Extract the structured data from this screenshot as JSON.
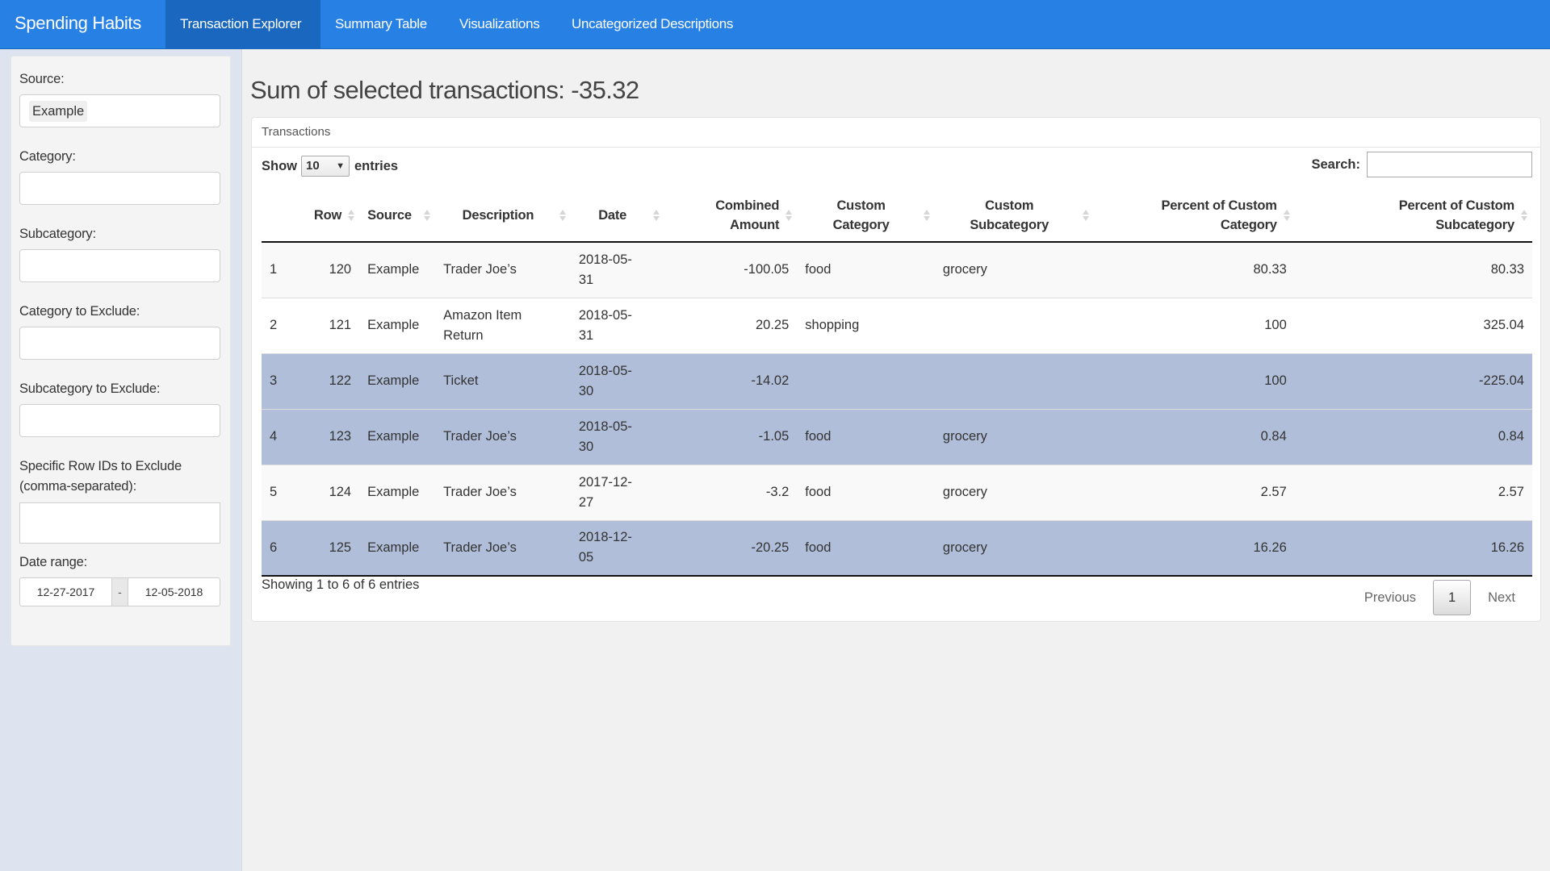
{
  "navbar": {
    "brand": "Spending Habits",
    "tabs": [
      {
        "label": "Transaction Explorer",
        "active": true
      },
      {
        "label": "Summary Table",
        "active": false
      },
      {
        "label": "Visualizations",
        "active": false
      },
      {
        "label": "Uncategorized Descriptions",
        "active": false
      }
    ]
  },
  "sidebar": {
    "source": {
      "label": "Source:",
      "selected": "Example"
    },
    "category": {
      "label": "Category:",
      "value": ""
    },
    "subcategory": {
      "label": "Subcategory:",
      "value": ""
    },
    "category_exclude": {
      "label": "Category to Exclude:",
      "value": ""
    },
    "subcategory_exclude": {
      "label": "Subcategory to Exclude:",
      "value": ""
    },
    "row_ids_exclude": {
      "label_line1": "Specific Row IDs to Exclude",
      "label_line2": "(comma-separated):",
      "value": ""
    },
    "date_range": {
      "label": "Date range:",
      "start": "12-27-2017",
      "separator": "-",
      "end": "12-05-2018"
    }
  },
  "main": {
    "summary": "Sum of selected transactions: -35.32",
    "box_title": "Transactions",
    "length": {
      "show": "Show",
      "value": "10",
      "arrow": "▼",
      "entries": "entries"
    },
    "search": {
      "label": "Search:",
      "value": ""
    },
    "columns": [
      {
        "key": "idx",
        "label": ""
      },
      {
        "key": "row",
        "label": "Row"
      },
      {
        "key": "source",
        "label": "Source"
      },
      {
        "key": "description",
        "label": "Description"
      },
      {
        "key": "date",
        "label": "Date"
      },
      {
        "key": "amount",
        "label_line1": "Combined",
        "label_line2": "Amount"
      },
      {
        "key": "custom_category",
        "label_line1": "Custom",
        "label_line2": "Category"
      },
      {
        "key": "custom_subcategory",
        "label_line1": "Custom",
        "label_line2": "Subcategory"
      },
      {
        "key": "pct_category",
        "label_line1": "Percent of Custom",
        "label_line2": "Category"
      },
      {
        "key": "pct_subcategory",
        "label_line1": "Percent of Custom",
        "label_line2": "Subcategory"
      }
    ],
    "rows": [
      {
        "idx": "1",
        "row": "120",
        "source": "Example",
        "description": "Trader Joe’s",
        "date_a": "2018-05-",
        "date_b": "31",
        "amount": "-100.05",
        "custom_category": "food",
        "custom_subcategory": "grocery",
        "pct_category": "80.33",
        "pct_subcategory": "80.33",
        "selected": false
      },
      {
        "idx": "2",
        "row": "121",
        "source": "Example",
        "description": "Amazon Item Return",
        "date_a": "2018-05-",
        "date_b": "31",
        "amount": "20.25",
        "custom_category": "shopping",
        "custom_subcategory": "",
        "pct_category": "100",
        "pct_subcategory": "325.04",
        "selected": false
      },
      {
        "idx": "3",
        "row": "122",
        "source": "Example",
        "description": "Ticket",
        "date_a": "2018-05-",
        "date_b": "30",
        "amount": "-14.02",
        "custom_category": "",
        "custom_subcategory": "",
        "pct_category": "100",
        "pct_subcategory": "-225.04",
        "selected": true
      },
      {
        "idx": "4",
        "row": "123",
        "source": "Example",
        "description": "Trader Joe’s",
        "date_a": "2018-05-",
        "date_b": "30",
        "amount": "-1.05",
        "custom_category": "food",
        "custom_subcategory": "grocery",
        "pct_category": "0.84",
        "pct_subcategory": "0.84",
        "selected": true
      },
      {
        "idx": "5",
        "row": "124",
        "source": "Example",
        "description": "Trader Joe’s",
        "date_a": "2017-12-",
        "date_b": "27",
        "amount": "-3.2",
        "custom_category": "food",
        "custom_subcategory": "grocery",
        "pct_category": "2.57",
        "pct_subcategory": "2.57",
        "selected": false
      },
      {
        "idx": "6",
        "row": "125",
        "source": "Example",
        "description": "Trader Joe’s",
        "date_a": "2018-12-",
        "date_b": "05",
        "amount": "-20.25",
        "custom_category": "food",
        "custom_subcategory": "grocery",
        "pct_category": "16.26",
        "pct_subcategory": "16.26",
        "selected": true
      }
    ],
    "info": "Showing 1 to 6 of 6 entries",
    "pagination": {
      "previous": "Previous",
      "current": "1",
      "next": "Next"
    }
  },
  "colors": {
    "navbar": "#2780e3",
    "navbar_active": "#1967be",
    "selected_row": "#b0bed9",
    "sidebar_bg": "#dee4ef"
  }
}
